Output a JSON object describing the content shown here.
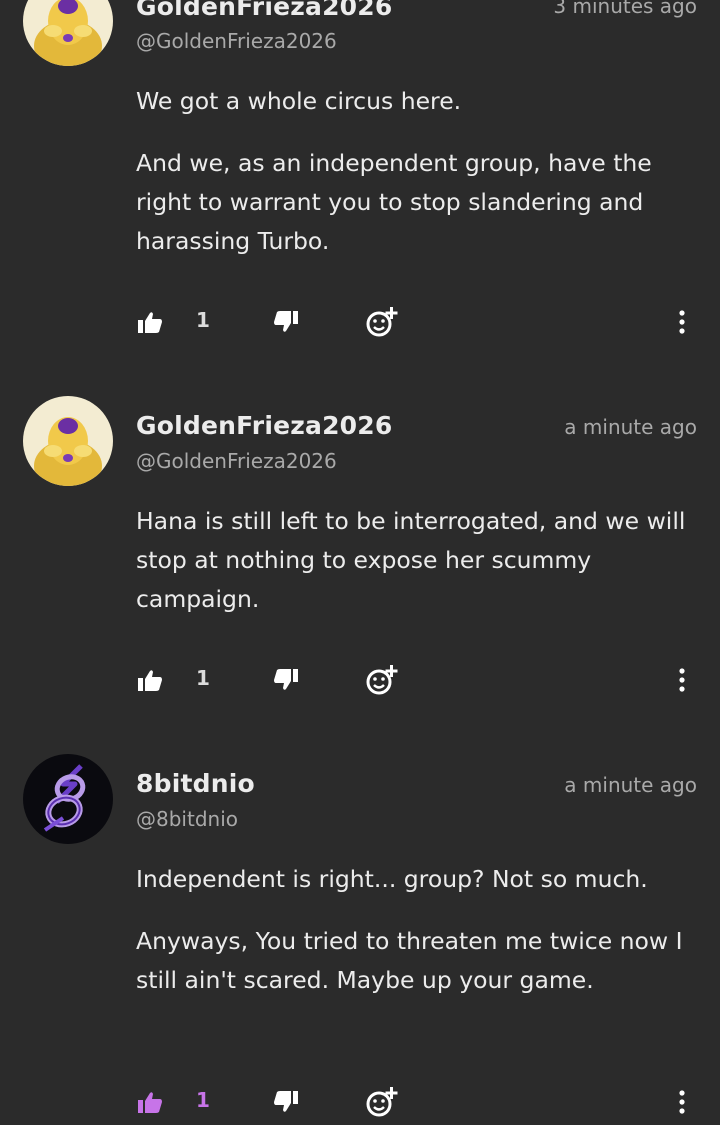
{
  "comments": [
    {
      "username": "GoldenFrieza2026",
      "handle": "@GoldenFrieza2026",
      "timestamp": "3 minutes ago",
      "avatar_icon": "golden-frieza-avatar",
      "paragraphs": [
        "We got a whole circus here.",
        "And we, as an independent group, have the right to warrant you to stop slandering and harassing Turbo."
      ],
      "like_count": "1",
      "liked": false
    },
    {
      "username": "GoldenFrieza2026",
      "handle": "@GoldenFrieza2026",
      "timestamp": "a minute ago",
      "avatar_icon": "golden-frieza-avatar",
      "paragraphs": [
        "Hana is still left to be interrogated, and we will stop at nothing to expose her scummy campaign."
      ],
      "like_count": "1",
      "liked": false
    },
    {
      "username": "8bitdnio",
      "handle": "@8bitdnio",
      "timestamp": "a minute ago",
      "avatar_icon": "purple-8-logo-avatar",
      "paragraphs": [
        "Independent is right... group? Not so much.",
        "Anyways, You tried to threaten me twice now I still ain't scared. Maybe up your game."
      ],
      "like_count": "1",
      "liked": true
    }
  ],
  "colors": {
    "background": "#2b2b2b",
    "text": "#ececec",
    "muted": "#a9a9a9",
    "accent_liked": "#c774e8"
  }
}
